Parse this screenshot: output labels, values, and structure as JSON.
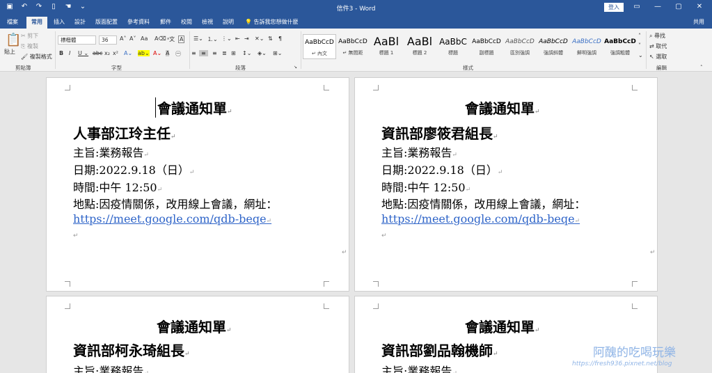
{
  "window": {
    "title": "信件3 - Word",
    "login": "登入",
    "controls": [
      "▭",
      "—",
      "▢",
      "✕"
    ]
  },
  "tabs": [
    "檔案",
    "常用",
    "插入",
    "設計",
    "版面配置",
    "參考資料",
    "郵件",
    "校閱",
    "檢視",
    "說明"
  ],
  "active_tab": "常用",
  "tellme": "告訴我您想做什麼",
  "share": "共用",
  "ribbon": {
    "clipboard": {
      "paste": "貼上",
      "cut": "剪下",
      "copy": "複製",
      "format_painter": "複製格式",
      "label": "剪貼簿"
    },
    "font": {
      "name": "標楷體",
      "size": "36",
      "label": "字型"
    },
    "paragraph": {
      "label": "段落"
    },
    "styles": {
      "label": "樣式",
      "items": [
        {
          "sample": "AaBbCcD",
          "name": "↵ 內文"
        },
        {
          "sample": "AaBbCcD",
          "name": "↵ 無間距"
        },
        {
          "sample": "AaBl",
          "name": "標題 1"
        },
        {
          "sample": "AaBl",
          "name": "標題 2"
        },
        {
          "sample": "AaBbC",
          "name": "標題"
        },
        {
          "sample": "AaBbCcD",
          "name": "副標題"
        },
        {
          "sample": "AaBbCcD",
          "name": "區別強調"
        },
        {
          "sample": "AaBbCcD",
          "name": "強調斜體"
        },
        {
          "sample": "AaBbCcD",
          "name": "鮮明強調"
        },
        {
          "sample": "AaBbCcD",
          "name": "強調粗體"
        }
      ]
    },
    "editing": {
      "find": "尋找",
      "replace": "取代",
      "select": "選取",
      "label": "編輯"
    }
  },
  "pages": [
    {
      "title": "會議通知單",
      "recipient": "人事部江玲主任",
      "subject": "主旨:業務報告",
      "date": "日期:2022.9.18（日）",
      "time": "時間:中午 12:50",
      "place": "地點:因疫情關係，改用線上會議，網址：",
      "link": "https://meet.google.com/qdb-beqe"
    },
    {
      "title": "會議通知單",
      "recipient": "資訊部廖筱君組長",
      "subject": "主旨:業務報告",
      "date": "日期:2022.9.18（日）",
      "time": "時間:中午 12:50",
      "place": "地點:因疫情關係，改用線上會議，網址：",
      "link": "https://meet.google.com/qdb-beqe"
    },
    {
      "title": "會議通知單",
      "recipient": "資訊部柯永琦組長",
      "subject": "主旨:業務報告"
    },
    {
      "title": "會議通知單",
      "recipient": "資訊部劉品翰機師",
      "subject": "主旨:業務報告"
    }
  ],
  "watermark": {
    "name": "阿醜的吃喝玩樂",
    "url": "https://fresh936.pixnet.net/blog"
  }
}
